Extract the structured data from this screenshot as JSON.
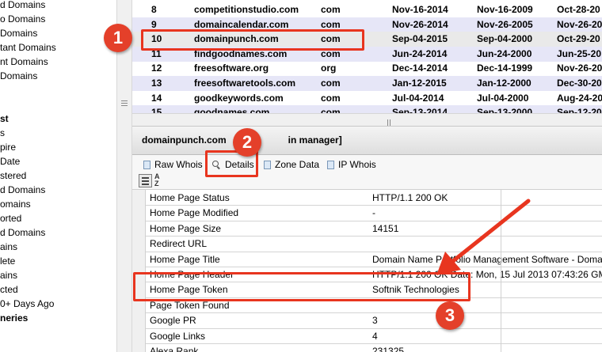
{
  "sidebar": {
    "items": [
      {
        "label": "d Domains",
        "bold": false
      },
      {
        "label": "o Domains",
        "bold": false
      },
      {
        "label": "Domains",
        "bold": false
      },
      {
        "label": "tant Domains",
        "bold": false
      },
      {
        "label": "nt Domains",
        "bold": false
      },
      {
        "label": "Domains",
        "bold": false
      },
      {
        "label": "",
        "bold": false
      },
      {
        "label": "",
        "bold": false
      },
      {
        "label": "st",
        "bold": true
      },
      {
        "label": "s",
        "bold": false
      },
      {
        "label": "pire",
        "bold": false
      },
      {
        "label": "Date",
        "bold": false
      },
      {
        "label": "stered",
        "bold": false
      },
      {
        "label": "d Domains",
        "bold": false
      },
      {
        "label": "omains",
        "bold": false
      },
      {
        "label": "orted",
        "bold": false
      },
      {
        "label": "d Domains",
        "bold": false
      },
      {
        "label": "ains",
        "bold": false
      },
      {
        "label": "lete",
        "bold": false
      },
      {
        "label": "ains",
        "bold": false
      },
      {
        "label": "cted",
        "bold": false
      },
      {
        "label": "0+ Days Ago",
        "bold": false
      },
      {
        "label": "neries",
        "bold": true
      }
    ]
  },
  "table": {
    "rows": [
      {
        "id": "8",
        "name": "competitionstudio.com",
        "tld": "com",
        "expires": "Nov-16-2014",
        "created": "Nov-16-2009",
        "updated": "Oct-28-20",
        "style": "normal"
      },
      {
        "id": "9",
        "name": "domaincalendar.com",
        "tld": "com",
        "expires": "Nov-26-2014",
        "created": "Nov-26-2005",
        "updated": "Nov-26-20",
        "style": "alt"
      },
      {
        "id": "10",
        "name": "domainpunch.com",
        "tld": "com",
        "expires": "Sep-04-2015",
        "created": "Sep-04-2000",
        "updated": "Oct-29-20",
        "style": "sel"
      },
      {
        "id": "11",
        "name": "findgoodnames.com",
        "tld": "com",
        "expires": "Jun-24-2014",
        "created": "Jun-24-2000",
        "updated": "Jun-25-20",
        "style": "alt"
      },
      {
        "id": "12",
        "name": "freesoftware.org",
        "tld": "org",
        "expires": "Dec-14-2014",
        "created": "Dec-14-1999",
        "updated": "Nov-26-20",
        "style": "normal"
      },
      {
        "id": "13",
        "name": "freesoftwaretools.com",
        "tld": "com",
        "expires": "Jan-12-2015",
        "created": "Jan-12-2000",
        "updated": "Dec-30-20",
        "style": "alt"
      },
      {
        "id": "14",
        "name": "goodkeywords.com",
        "tld": "com",
        "expires": "Jul-04-2014",
        "created": "Jul-04-2000",
        "updated": "Aug-24-20",
        "style": "normal"
      },
      {
        "id": "15",
        "name": "goodnames.com",
        "tld": "com",
        "expires": "Sep-13-2014",
        "created": "Sep-13-2000",
        "updated": "Sep-12-20",
        "style": "alt"
      }
    ]
  },
  "detail": {
    "title_start": "domainpunch.com",
    "title_end": "in manager]"
  },
  "tabs": {
    "raw_whois": "Raw Whois",
    "details": "Details",
    "zone_data": "Zone Data",
    "ip_whois": "IP Whois"
  },
  "toolbar": {
    "sort_alpha_top": "A",
    "sort_alpha_bottom": "Z"
  },
  "properties": [
    {
      "name": "Home Page Status",
      "value": "HTTP/1.1 200 OK"
    },
    {
      "name": "Home Page Modified",
      "value": "-"
    },
    {
      "name": "Home Page Size",
      "value": "14151"
    },
    {
      "name": "Redirect URL",
      "value": ""
    },
    {
      "name": "Home Page Title",
      "value": "Domain Name Portfolio Management Software - Doma"
    },
    {
      "name": "Home Page Header",
      "value": "HTTP/1.1 200 OK Date: Mon, 15 Jul 2013 07:43:26 GMT Se"
    },
    {
      "name": "Home Page Token",
      "value": "Softnik Technologies"
    },
    {
      "name": "Page Token Found",
      "value": ""
    },
    {
      "name": "Google PR",
      "value": "3"
    },
    {
      "name": "Google Links",
      "value": "4"
    },
    {
      "name": "Alexa Rank",
      "value": "231325"
    }
  ],
  "annotations": {
    "badge_1": "1",
    "badge_2": "2",
    "badge_3": "3",
    "accent_color": "#e4402a"
  }
}
